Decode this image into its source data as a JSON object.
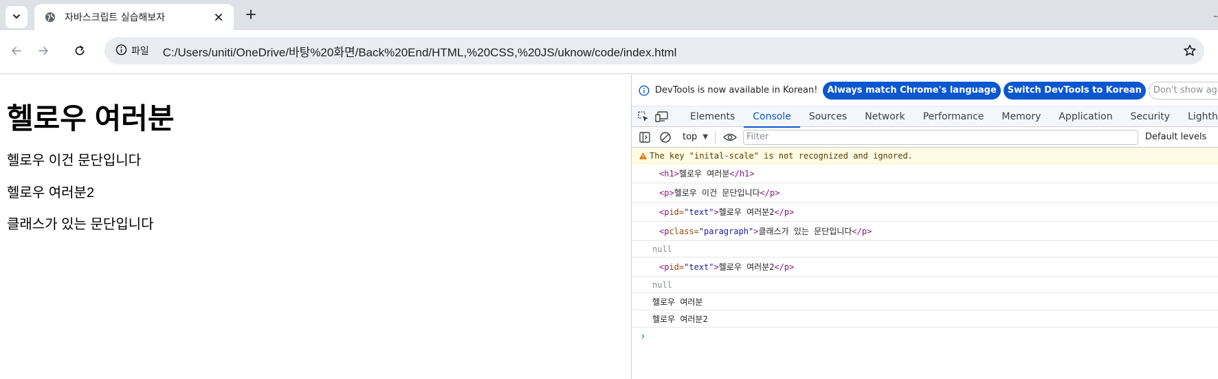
{
  "browser": {
    "tab_title": "자바스크립트 실습해보자",
    "site_chip_label": "파일",
    "url": "C:/Users/uniti/OneDrive/바탕%20화면/Back%20End/HTML,%20CSS,%20JS/uknow/code/index.html"
  },
  "page": {
    "heading": "헬로우 여러분",
    "paragraphs": [
      "헬로우 이건 문단입니다",
      "헬로우 여러분2",
      "클래스가 있는 문단입니다"
    ]
  },
  "devtools": {
    "infobar": {
      "message": "DevTools is now available in Korean!",
      "match_button": "Always match Chrome's language",
      "switch_button": "Switch DevTools to Korean",
      "dismiss_button": "Don't show again"
    },
    "tabs": [
      "Elements",
      "Console",
      "Sources",
      "Network",
      "Performance",
      "Memory",
      "Application",
      "Security",
      "Lighthouse"
    ],
    "active_tab": "Console",
    "console_toolbar": {
      "context": "top",
      "filter_placeholder": "Filter",
      "levels": "Default levels"
    },
    "console": {
      "warning": "The key \"inital-scale\" is not recognized and ignored.",
      "entries": {
        "h1_open": "<h1>",
        "h1_text": "헬로우 여러분",
        "h1_close": "</h1>",
        "p_open": "<p>",
        "p_text": "헬로우 이건 문단입니다",
        "p_close": "</p>",
        "pid_open": "<p",
        "pid_attr": " id=",
        "pid_val": "\"text\"",
        "pid_gt": ">",
        "pid_text": "헬로우 여러분2",
        "pid_close": "</p>",
        "pc_open": "<p",
        "pc_attr": " class=",
        "pc_val": "\"paragraph\"",
        "pc_gt": ">",
        "pc_text": "클래스가 있는 문단입니다",
        "pc_close": "</p>",
        "null1": "null",
        "pid2_open": "<p",
        "pid2_attr": " id=",
        "pid2_val": "\"text\"",
        "pid2_gt": ">",
        "pid2_text": "헬로우 여러분2",
        "pid2_close": "</p>",
        "null2": "null",
        "log1": "헬로우 여러분",
        "log2": "헬로우 여러분2"
      },
      "prompt": "›"
    }
  }
}
